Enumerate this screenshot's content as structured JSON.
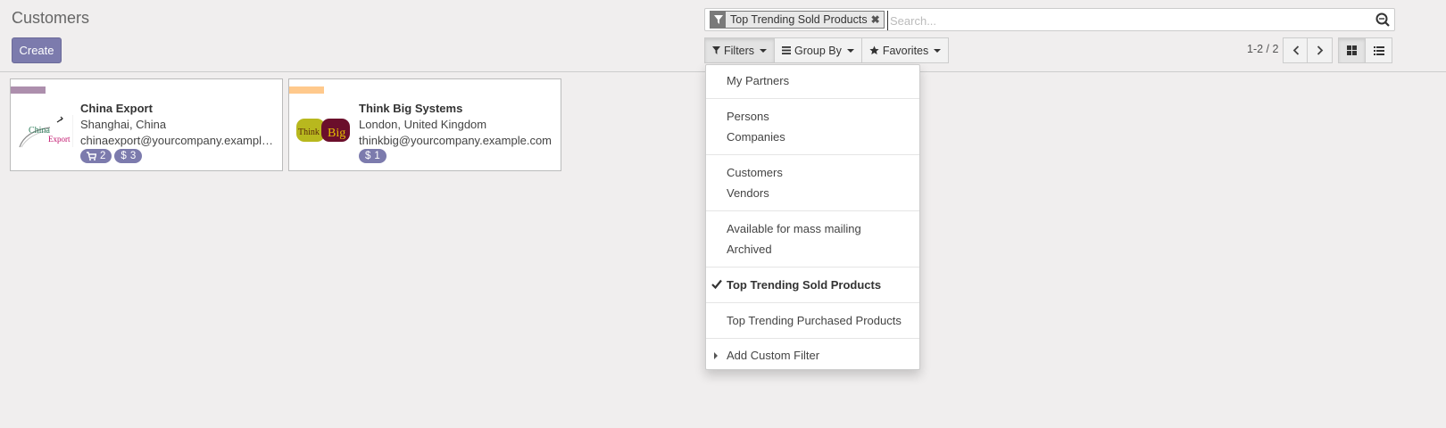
{
  "page": {
    "title": "Customers"
  },
  "toolbar": {
    "create_label": "Create"
  },
  "search": {
    "facet_label": "Top Trending Sold Products",
    "placeholder": "Search..."
  },
  "search_options": {
    "filters_label": "Filters",
    "groupby_label": "Group By",
    "favorites_label": "Favorites"
  },
  "pager": {
    "value": "1-2 / 2"
  },
  "cards": [
    {
      "name": "China Export",
      "location": "Shanghai, China",
      "email": "chinaexport@yourcompany.example.com",
      "color": "#ad8fad",
      "logo_text_1": "China",
      "logo_text_2": "Export",
      "badges": [
        {
          "icon": "cart-icon",
          "value": "2"
        },
        {
          "icon": "dollar-icon",
          "value": "3"
        }
      ]
    },
    {
      "name": "Think Big Systems",
      "location": "London, United Kingdom",
      "email": "thinkbig@yourcompany.example.com",
      "color": "#ffc98c",
      "logo_text_1": "Think",
      "logo_text_2": "Big",
      "badges": [
        {
          "icon": "dollar-icon",
          "value": "1"
        }
      ]
    }
  ],
  "filters_menu": {
    "groups": [
      [
        "My Partners"
      ],
      [
        "Persons",
        "Companies"
      ],
      [
        "Customers",
        "Vendors"
      ],
      [
        "Available for mass mailing",
        "Archived"
      ],
      [
        "Top Trending Sold Products"
      ],
      [
        "Top Trending Purchased Products"
      ]
    ],
    "selected": "Top Trending Sold Products",
    "custom_filter_label": "Add Custom Filter"
  },
  "colors": {
    "accent": "#7c7bad"
  }
}
